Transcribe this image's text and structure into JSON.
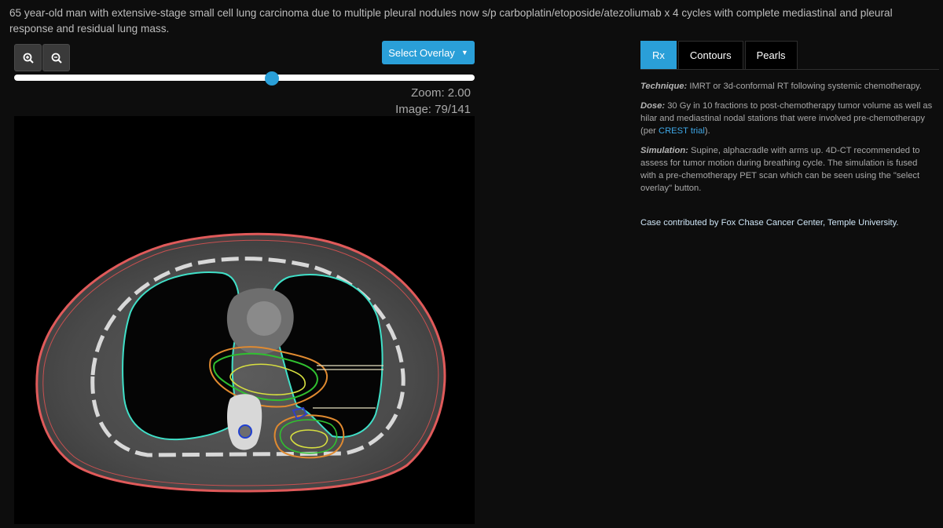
{
  "case": {
    "description": "65 year-old man with extensive-stage small cell lung carcinoma due to multiple pleural nodules now s/p carboplatin/etoposide/atezoliumab x 4 cycles with complete mediastinal and pleural response and residual lung mass."
  },
  "toolbar": {
    "zoom_in_icon": "zoom-in-icon",
    "zoom_out_icon": "zoom-out-icon",
    "overlay_label": "Select Overlay",
    "accent_color": "#2a9fd8"
  },
  "viewer": {
    "slider_value": 0.56,
    "zoom_label": "Zoom: 2.00",
    "image_label": "Image: 79/141"
  },
  "tabs": [
    {
      "label": "Rx",
      "active": true
    },
    {
      "label": "Contours",
      "active": false
    },
    {
      "label": "Pearls",
      "active": false
    }
  ],
  "rx": {
    "technique_label": "Technique:",
    "technique_text": " IMRT or 3d-conformal RT following systemic chemotherapy.",
    "dose_label": "Dose:",
    "dose_text": " 30 Gy in 10 fractions to post-chemotherapy tumor volume as well as hilar and mediastinal nodal stations that were involved pre-chemotherapy (per ",
    "dose_link": "CREST trial",
    "dose_end": ").",
    "simulation_label": "Simulation:",
    "simulation_text": " Supine, alphacradle with arms up. 4D-CT recommended to assess for tumor motion during breathing cycle. The simulation is fused with a pre-chemotherapy PET scan which can be seen using the \"select overlay\" button."
  },
  "credit": "Case contributed by Fox Chase Cancer Center, Temple University.",
  "contour_colors": {
    "body": "#e05a5a",
    "lungs": "#40e0c8",
    "itv": "#e08a30",
    "ctv": "#30c030",
    "gtv": "#d8e040",
    "cord": "#2040d0"
  }
}
